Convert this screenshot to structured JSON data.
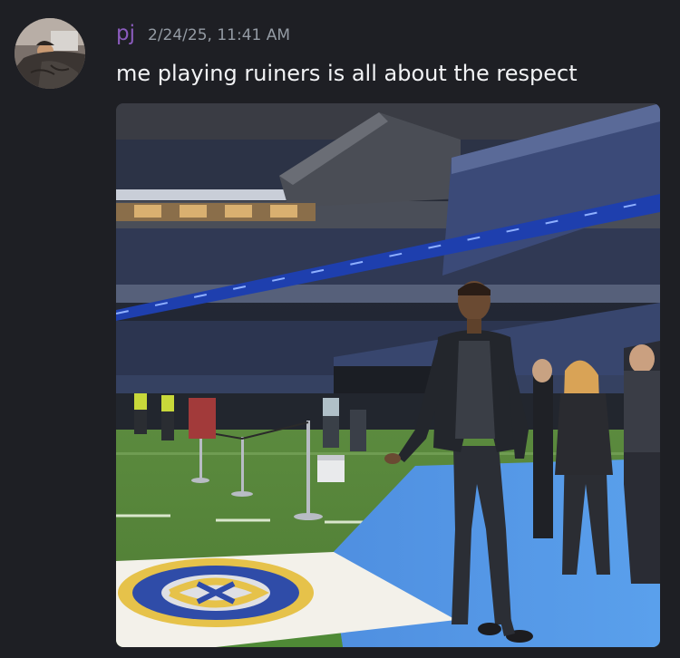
{
  "message": {
    "author": "pj",
    "timestamp": "2/24/25, 11:41 AM",
    "text": "me playing ruiners is all about the respect",
    "author_color": "#8b5bbd"
  },
  "avatar": {
    "icon": "user-avatar-icon"
  },
  "attachment": {
    "type": "video-still",
    "icon": "image-attachment-icon"
  }
}
